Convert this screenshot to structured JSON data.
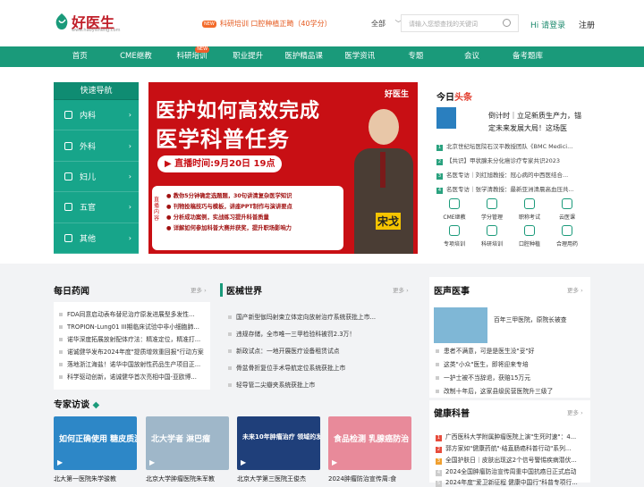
{
  "header": {
    "logo_text": "好医生",
    "logo_sub": "www.haoyisheng.com",
    "promo_new": "NEW",
    "promo_text": "科研培训 口腔种植正畸（40学分）",
    "search_scope": "全部",
    "search_placeholder": "请输入您想查找的关键词",
    "login_prefix": "Hi 请登录",
    "register": "注册"
  },
  "nav": {
    "items": [
      "首页",
      "CME继教",
      "科研培训",
      "职业提升",
      "医护精品课",
      "医学资讯",
      "专题",
      "会议",
      "备考题库"
    ],
    "new_badge": "NEW"
  },
  "quick_nav": {
    "title": "快速导航",
    "items": [
      "内科",
      "外科",
      "妇儿",
      "五官",
      "其他"
    ]
  },
  "banner": {
    "brand": "好医生",
    "line1": "医护如何高效完成",
    "line2": "医学科普任务",
    "live": "直播时间:9月20日 19点",
    "side": "直播内容",
    "points": [
      "教你5分钟确定选题题，30句讲清复杂医学知识",
      "刊物投稿技巧与模板，讲座PPT制作与演讲要点",
      "分析成功案例，实战练习提升科普质量",
      "详解如何参加科普大赛并获奖，提升职场影响力"
    ],
    "name": "宋戈"
  },
  "today": {
    "title_a": "今日",
    "title_b": "头条",
    "feature": "倒计时｜立足新质生产力，锚定未来发展大局！这场医",
    "list": [
      "北京世纪坛医院石汉平教授团队《BMC Medici...",
      "【共识】甲状腺未分化癌诊疗专家共识2023",
      "名医专访｜刘红旭教授：冠心病的中西医结合...",
      "名医专访｜张学清教授：最新亚洲清晨高血压共..."
    ],
    "grid": [
      "CME继教",
      "学分管理",
      "职称考试",
      "云医课",
      "专项培训",
      "科研培训",
      "口腔种植",
      "合理用药"
    ]
  },
  "news": {
    "title": "每日药闻",
    "more": "更多",
    "items": [
      "FDA同意启动表布替尼治疗原发进展型多发性...",
      "TROPION-Lung01 III期临床试验中非小细胞肺...",
      "诺华深度拓展放射配体疗法：精准定位，精准打...",
      "诺诚健华发布2024年度\"提质增效重回报\"行动方案",
      "落地浙江海盐！诺华中国放射性药品生产项目正...",
      "科学驱动创新，诺诚健华首次亮相中国-亚欧博..."
    ]
  },
  "device": {
    "title": "医械世界",
    "more": "更多",
    "items": [
      "国产新型伽玛射束立体定向放射治疗系统获批上市...",
      "违规存储，全市唯一三甲检验科被罚2.3万！",
      "新政试点：一地开展医疗设备租赁试点",
      "骨盆骨折复位手术导航定位系统获批上市",
      "轻导管二尖瓣夹系统获批上市"
    ]
  },
  "doctor": {
    "title": "医声医事",
    "more": "更多",
    "feature": "百年三甲医院，原院长被查",
    "items": [
      "患者不满意，可是是医生没\"妥\"好",
      "这类\"小众\"医生，即将迎来专培",
      "一护士被不当辞退，获赔15万元",
      "改制十年后，这家县级民营医院升三级了"
    ]
  },
  "health": {
    "title": "健康科普",
    "more": "更多",
    "items": [
      "广西医科大学附属肿瘤医院上演\"生死时速\"：4...",
      "郭方家如\"健康药航\"·结直肠癌科普行动\"系列...",
      "全国护肤日｜皮肤出现这2个信号警惕疾病潜伏...",
      "2024全国肿瘤防治宣传周重中国抗癌日正式启动",
      "2024年度\"爱卫新征程 健康中国行\"科普专项行..."
    ]
  },
  "interview": {
    "title": "专家访谈",
    "thumbs": [
      "如何正确使用 糖皮质激素?",
      "北大学者 淋巴瘤",
      "未来10年肿瘤治疗 领域的发展方向",
      "食品检测 乳腺癌防治"
    ],
    "captions": [
      "北大第一医院朱学骏教",
      "北京大学肿瘤医院朱军教",
      "北京大学第三医院王俊杰",
      "2024肿瘤防治宣传周:食"
    ]
  }
}
